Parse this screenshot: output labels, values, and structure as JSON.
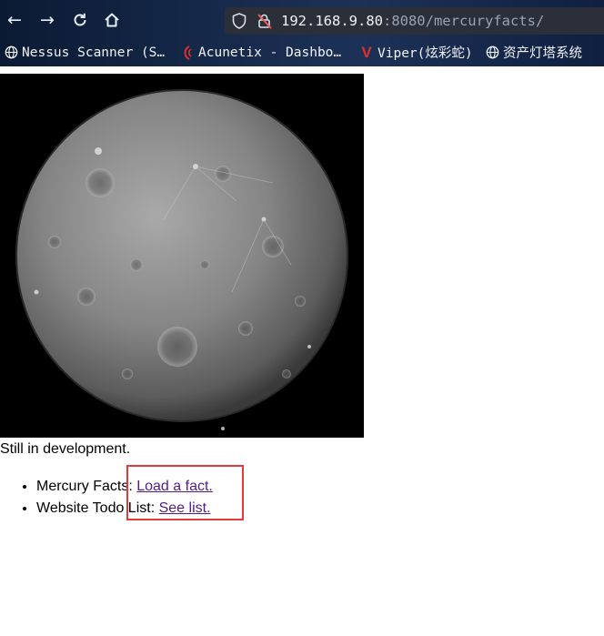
{
  "browser": {
    "url_host": "192.168.9.80",
    "url_rest": ":8080/mercuryfacts/",
    "nav": {
      "back_icon": "back-arrow-icon",
      "forward_icon": "forward-arrow-icon",
      "reload_icon": "reload-icon",
      "home_icon": "home-icon"
    },
    "bookmarks": [
      {
        "label": "Nessus Scanner (S…",
        "icon": "globe-icon"
      },
      {
        "label": "Acunetix - Dashbo…",
        "icon": "acunetix-icon"
      },
      {
        "label": "Viper(炫彩蛇)",
        "icon": "viper-icon"
      },
      {
        "label": "资产灯塔系统",
        "icon": "globe-icon"
      }
    ]
  },
  "page": {
    "status_text": "Still in development.",
    "items": [
      {
        "prefix": "Mercury Facts: ",
        "link": "Load a fact."
      },
      {
        "prefix": "Website Todo List: ",
        "link": "See list."
      }
    ]
  },
  "colors": {
    "link": "#551a8b",
    "highlight": "#e03a3a"
  }
}
